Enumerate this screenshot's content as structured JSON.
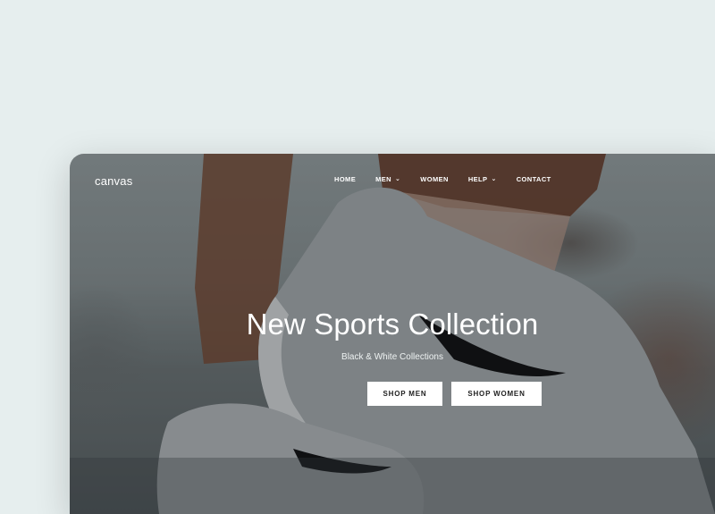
{
  "site": {
    "logo": "canvas"
  },
  "nav": {
    "items": [
      {
        "label": "HOME",
        "has_dropdown": false
      },
      {
        "label": "MEN",
        "has_dropdown": true
      },
      {
        "label": "WOMEN",
        "has_dropdown": false
      },
      {
        "label": "HELP",
        "has_dropdown": true
      },
      {
        "label": "CONTACT",
        "has_dropdown": false
      }
    ],
    "dropdown_icon": "chevron-down-icon"
  },
  "hero": {
    "title": "New Sports Collection",
    "subtitle": "Black & White Collections",
    "buttons": {
      "men": "SHOP MEN",
      "women": "SHOP WOMEN"
    }
  },
  "colors": {
    "page_background": "#e6eeee",
    "text_on_hero": "#ffffff",
    "button_background": "#ffffff",
    "button_text": "#222222"
  }
}
